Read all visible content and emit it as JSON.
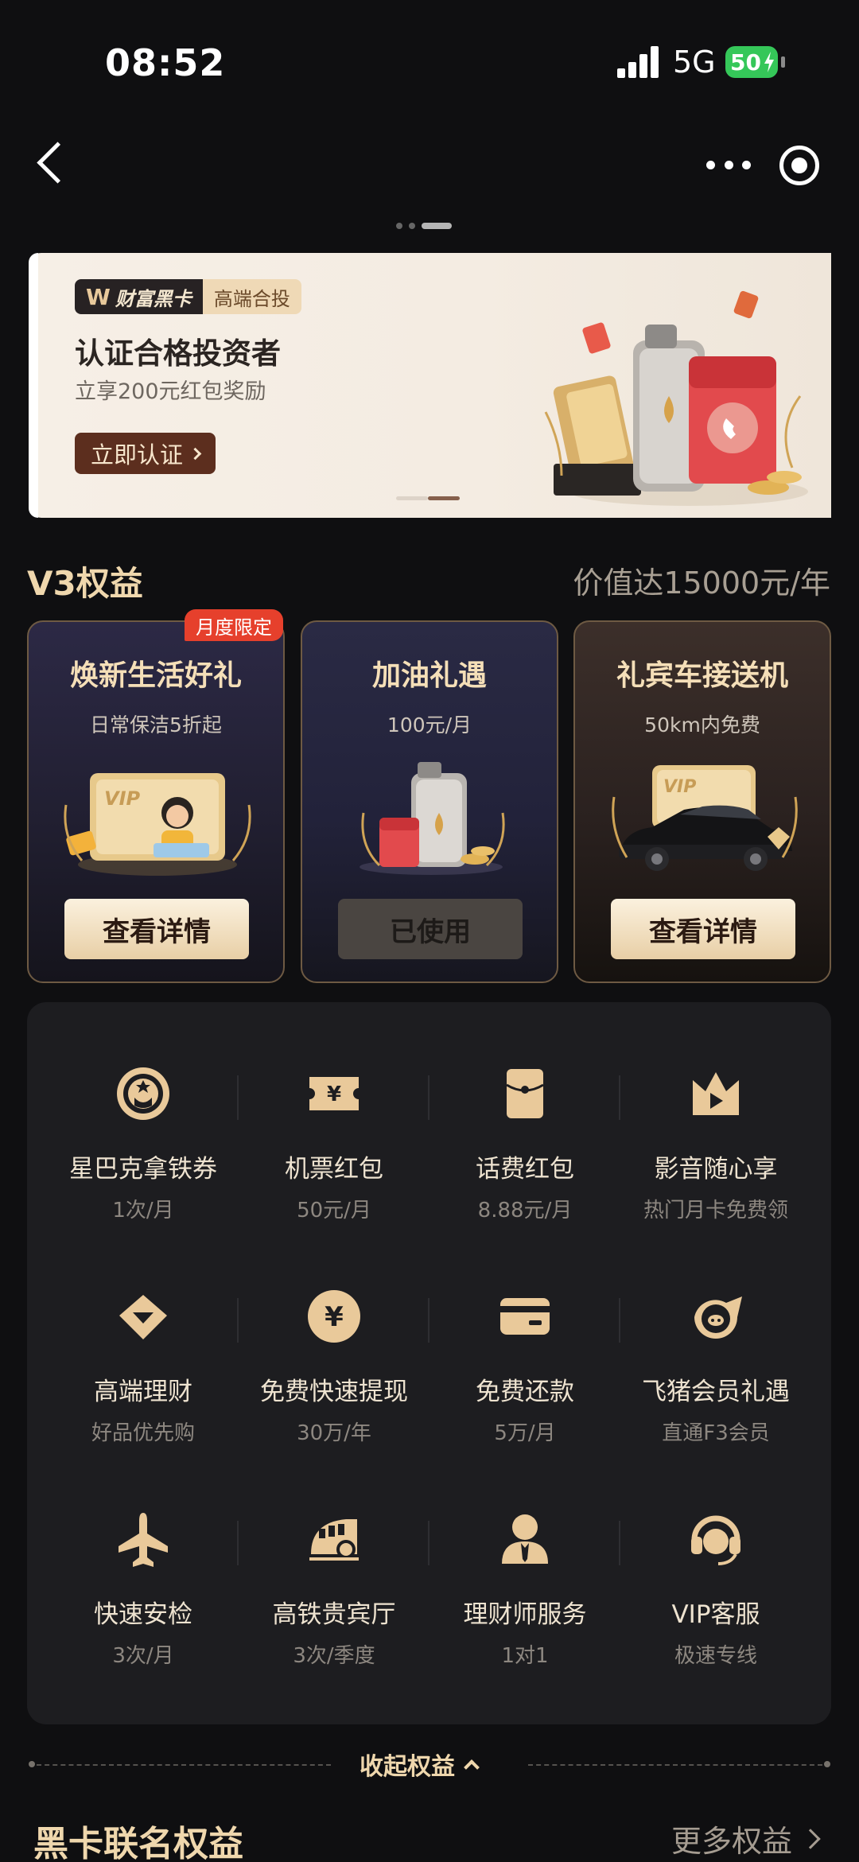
{
  "status": {
    "time": "08:52",
    "network": "5G",
    "battery": "50"
  },
  "banner": {
    "brand": "财富黑卡",
    "tag": "高端合投",
    "title": "认证合格投资者",
    "subtitle": "立享200元红包奖励",
    "button": "立即认证"
  },
  "section": {
    "title": "V3权益",
    "value": "价值达15000元/年"
  },
  "cards": [
    {
      "title": "焕新生活好礼",
      "sub": "日常保洁5折起",
      "button": "查看详情",
      "badge": "月度限定"
    },
    {
      "title": "加油礼遇",
      "sub": "100元/月",
      "button": "已使用"
    },
    {
      "title": "礼宾车接送机",
      "sub": "50km内免费",
      "button": "查看详情"
    }
  ],
  "benefits": [
    {
      "label": "星巴克拿铁券",
      "sub": "1次/月",
      "icon": "starbucks-icon"
    },
    {
      "label": "机票红包",
      "sub": "50元/月",
      "icon": "ticket-icon"
    },
    {
      "label": "话费红包",
      "sub": "8.88元/月",
      "icon": "red-envelope-icon"
    },
    {
      "label": "影音随心享",
      "sub": "热门月卡免费领",
      "icon": "video-crown-icon"
    },
    {
      "label": "高端理财",
      "sub": "好品优先购",
      "icon": "diamond-icon"
    },
    {
      "label": "免费快速提现",
      "sub": "30万/年",
      "icon": "yuan-coin-icon"
    },
    {
      "label": "免费还款",
      "sub": "5万/月",
      "icon": "card-icon"
    },
    {
      "label": "飞猪会员礼遇",
      "sub": "直通F3会员",
      "icon": "fliggy-icon"
    },
    {
      "label": "快速安检",
      "sub": "3次/月",
      "icon": "airplane-icon"
    },
    {
      "label": "高铁贵宾厅",
      "sub": "3次/季度",
      "icon": "train-icon"
    },
    {
      "label": "理财师服务",
      "sub": "1对1",
      "icon": "advisor-icon"
    },
    {
      "label": "VIP客服",
      "sub": "极速专线",
      "icon": "headset-icon"
    }
  ],
  "collapse": {
    "label": "收起权益"
  },
  "cobrand": {
    "title": "黑卡联名权益",
    "more": "更多权益"
  },
  "colors": {
    "gold": "#efd7ad",
    "badge": "#e6402c",
    "background": "#0f0f11"
  }
}
